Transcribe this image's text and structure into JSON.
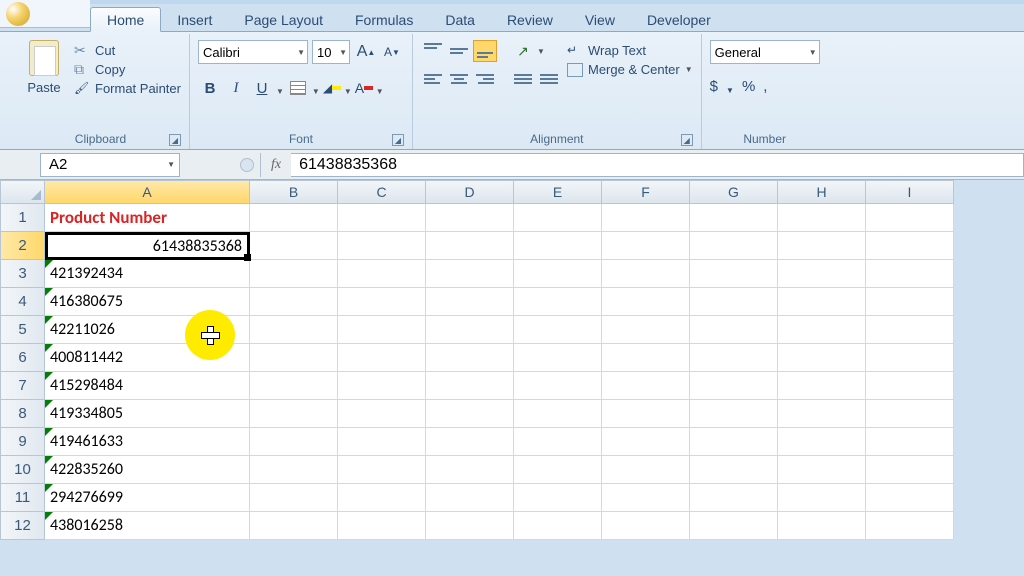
{
  "tabs": [
    "Home",
    "Insert",
    "Page Layout",
    "Formulas",
    "Data",
    "Review",
    "View",
    "Developer"
  ],
  "active_tab": 0,
  "clipboard": {
    "paste": "Paste",
    "cut": "Cut",
    "copy": "Copy",
    "painter": "Format Painter",
    "title": "Clipboard"
  },
  "font": {
    "name": "Calibri",
    "size": "10",
    "grow": "A",
    "shrink": "A",
    "bold": "B",
    "italic": "I",
    "underline": "U",
    "font_color_letter": "A",
    "title": "Font"
  },
  "alignment": {
    "wrap": "Wrap Text",
    "merge": "Merge & Center",
    "title": "Alignment"
  },
  "number": {
    "format": "General",
    "currency": "$",
    "percent": "%",
    "comma": ",",
    "title": "Number"
  },
  "name_box": "A2",
  "formula_value": "61438835368",
  "columns": [
    "A",
    "B",
    "C",
    "D",
    "E",
    "F",
    "G",
    "H",
    "I"
  ],
  "header_label": "Product Number",
  "selected_value": "61438835368",
  "rows": [
    "1",
    "2",
    "3",
    "4",
    "5",
    "6",
    "7",
    "8",
    "9",
    "10",
    "11",
    "12"
  ],
  "data": [
    "421392434",
    "416380675",
    "42211026",
    "400811442",
    "415298484",
    "419334805",
    "419461633",
    "422835260",
    "294276699",
    "438016258"
  ]
}
